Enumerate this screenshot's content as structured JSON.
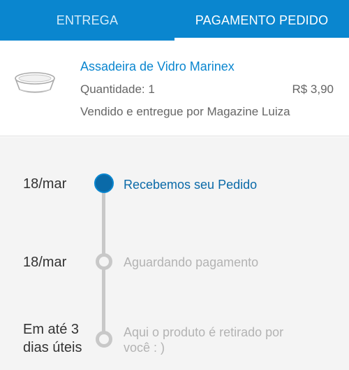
{
  "tabs": [
    {
      "label": "ENTREGA",
      "active": false
    },
    {
      "label": "PAGAMENTO PEDIDO",
      "active": true
    }
  ],
  "product": {
    "name": "Assadeira de Vidro Marinex",
    "quantity": "Quantidade: 1",
    "price": "R$ 3,90",
    "seller": "Vendido e entregue por Magazine Luiza",
    "thumb_icon": "glass-baking-dish-icon"
  },
  "timeline": {
    "steps": [
      {
        "date": "18/mar",
        "label": "Recebemos seu Pedido",
        "status": "done"
      },
      {
        "date": "18/mar",
        "label": "Aguardando pagamento",
        "status": "pending"
      },
      {
        "date_line1": "Em até 3",
        "date_line2": "dias úteis",
        "label_line1": "Aqui o produto é retirado por",
        "label_line2": "você : )",
        "status": "pending"
      }
    ]
  },
  "colors": {
    "brand_blue": "#0a86cf",
    "step_done": "#0a6aa8",
    "step_pending": "#c8c8c8"
  }
}
